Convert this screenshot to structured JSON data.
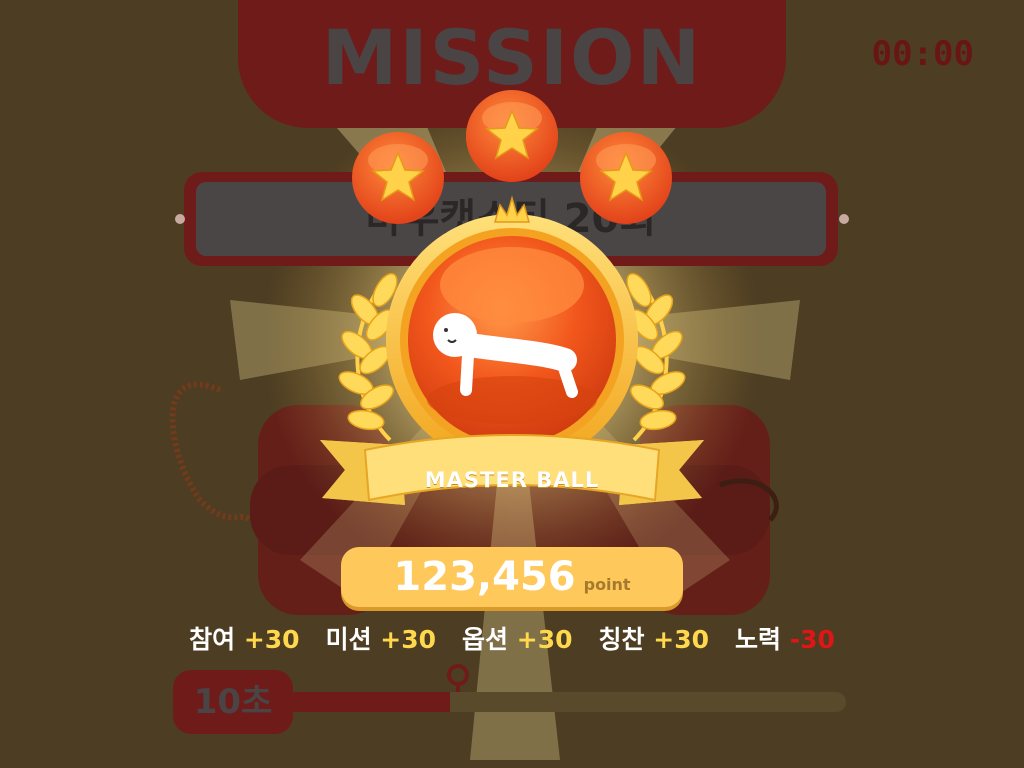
{
  "header": {
    "title": "MISSION",
    "timer": "00:00"
  },
  "task": {
    "text": "마우캣스티 20회"
  },
  "reward": {
    "stars_earned": 3,
    "stars_total": 3,
    "badge_name": "MASTER BALL",
    "character_icon": "plank-figure-icon",
    "points_value": "123,456",
    "points_unit": "point"
  },
  "score_breakdown": [
    {
      "label": "참여",
      "value": "+30",
      "kind": "positive"
    },
    {
      "label": "미션",
      "value": "+30",
      "kind": "positive"
    },
    {
      "label": "옵션",
      "value": "+30",
      "kind": "positive"
    },
    {
      "label": "칭찬",
      "value": "+30",
      "kind": "positive"
    },
    {
      "label": "노력",
      "value": "-30",
      "kind": "negative"
    }
  ],
  "timebar": {
    "label": "10초",
    "progress": 0.3
  },
  "colors": {
    "background": "#4d3d22",
    "banner": "#6f1b1a",
    "positive": "#ffd84d",
    "negative": "#e01515",
    "ball": "#f25a1e",
    "gold": "#ffc83a"
  }
}
